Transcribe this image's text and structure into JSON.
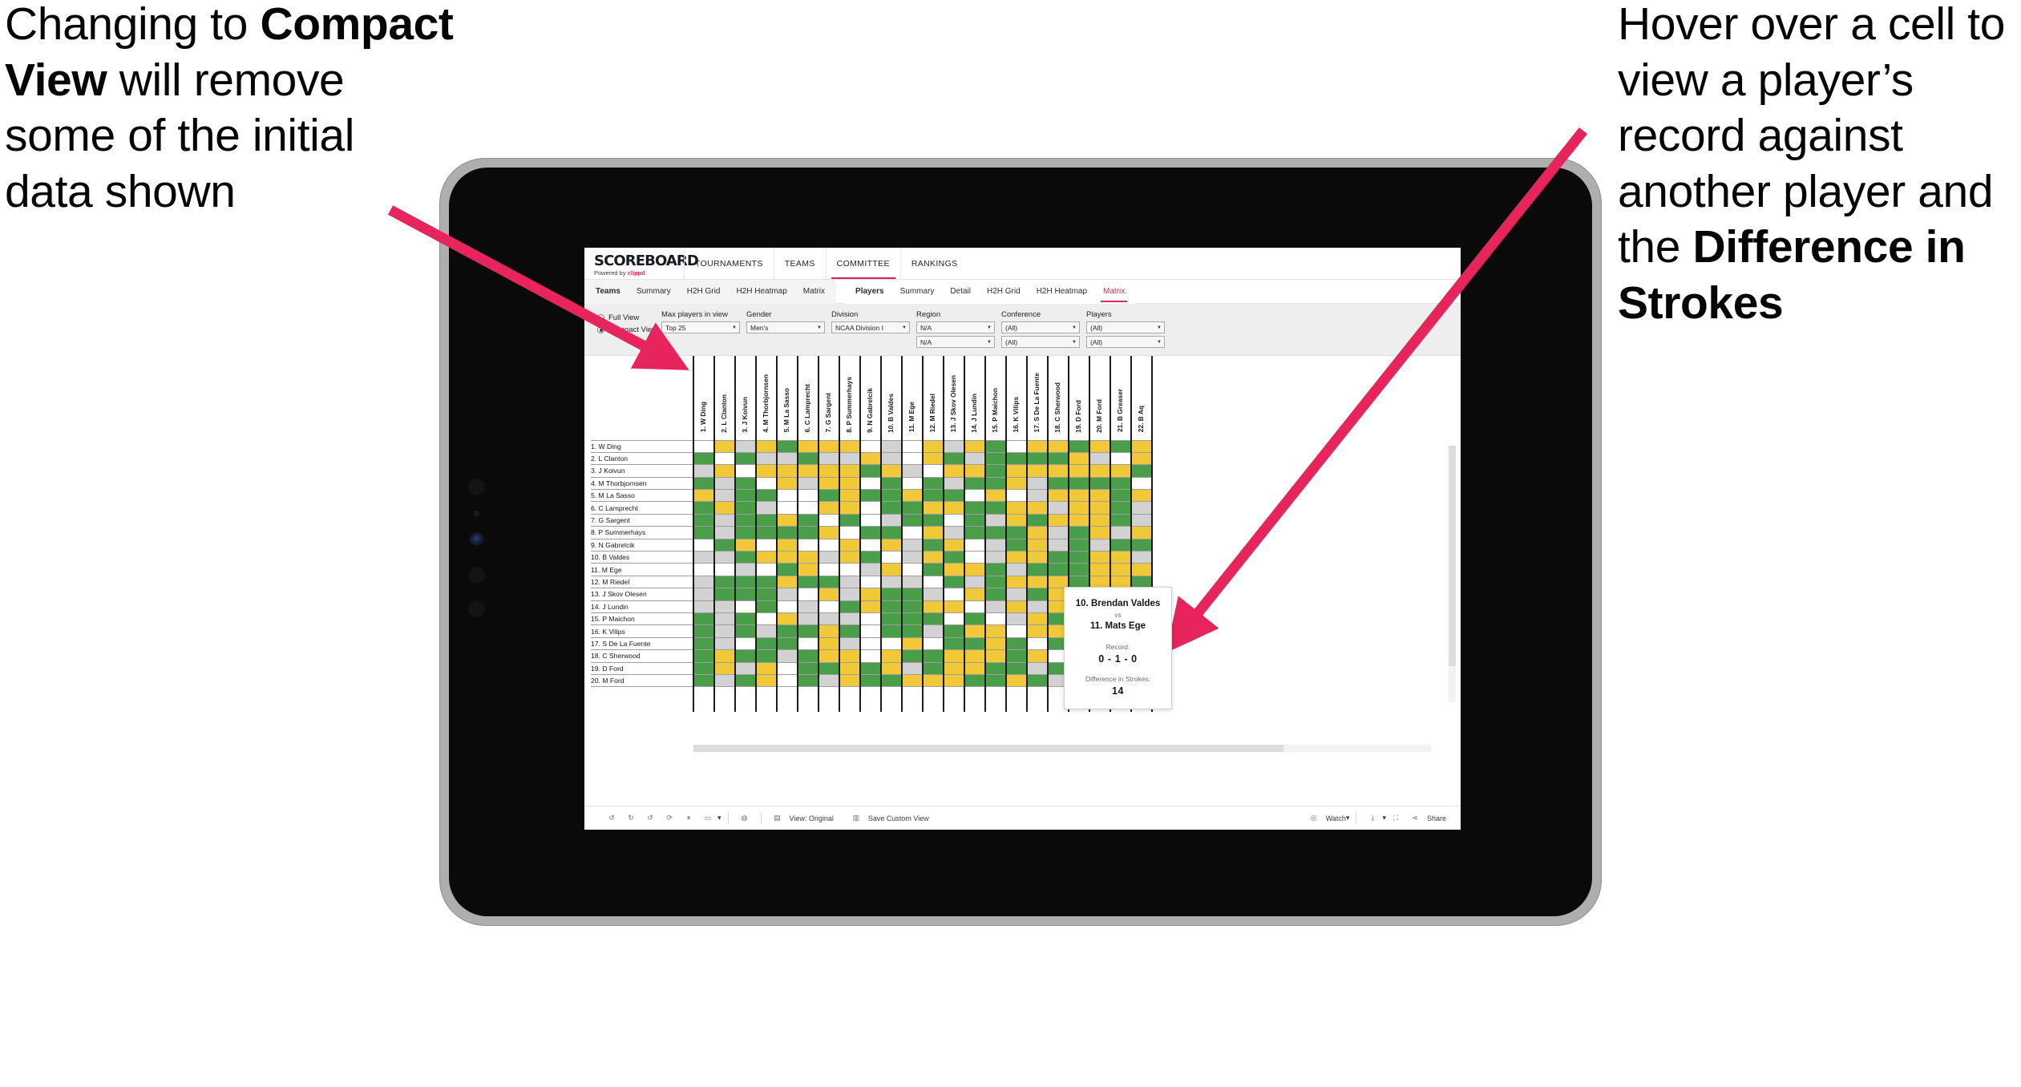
{
  "annotations": {
    "left": {
      "part1": "Changing to ",
      "bold": "Compact View",
      "part2": " will remove some of the initial data shown"
    },
    "right": {
      "part1": "Hover over a cell to view a player’s record against another player and the ",
      "bold": "Difference in Strokes",
      "part2": ""
    },
    "arrow_color": "#e8245d"
  },
  "app": {
    "brand": {
      "title": "SCOREBOARD",
      "sub_prefix": "Powered by ",
      "sub_brand": "clippd"
    },
    "topnav": [
      {
        "label": "TOURNAMENTS",
        "active": false
      },
      {
        "label": "TEAMS",
        "active": false
      },
      {
        "label": "COMMITTEE",
        "active": true
      },
      {
        "label": "RANKINGS",
        "active": false
      }
    ],
    "tabs_teams": [
      {
        "label": "Teams",
        "head": true,
        "active": false
      },
      {
        "label": "Summary",
        "head": false,
        "active": false
      },
      {
        "label": "H2H Grid",
        "head": false,
        "active": false
      },
      {
        "label": "H2H Heatmap",
        "head": false,
        "active": false
      },
      {
        "label": "Matrix",
        "head": false,
        "active": false
      }
    ],
    "tabs_players": [
      {
        "label": "Players",
        "head": true,
        "active": false
      },
      {
        "label": "Summary",
        "head": false,
        "active": false
      },
      {
        "label": "Detail",
        "head": false,
        "active": false
      },
      {
        "label": "H2H Grid",
        "head": false,
        "active": false
      },
      {
        "label": "H2H Heatmap",
        "head": false,
        "active": false
      },
      {
        "label": "Matrix",
        "head": false,
        "active": true
      }
    ],
    "filters": {
      "view_modes": [
        {
          "label": "Full View",
          "selected": false
        },
        {
          "label": "Compact View",
          "selected": true
        }
      ],
      "max_players": {
        "label": "Max players in view",
        "value": "Top 25"
      },
      "gender": {
        "label": "Gender",
        "value": "Men's"
      },
      "division": {
        "label": "Division",
        "value": "NCAA Division I"
      },
      "region": {
        "label": "Region",
        "value": "N/A",
        "value2": "N/A"
      },
      "conference": {
        "label": "Conference",
        "value": "(All)",
        "value2": "(All)"
      },
      "players": {
        "label": "Players",
        "value": "(All)",
        "value2": "(All)"
      }
    },
    "toolbar": {
      "view_label": "View: Original",
      "save_label": "Save Custom View",
      "watch_label": "Watch",
      "share_label": "Share"
    },
    "tooltip": {
      "player_a": "10. Brendan Valdes",
      "vs": "vs",
      "player_b": "11. Mats Ege",
      "record_label": "Record:",
      "record_value": "0 - 1 - 0",
      "diff_label": "Difference in Strokes:",
      "diff_value": "14"
    }
  },
  "matrix": {
    "columns": [
      "1. W Ding",
      "2. L Clanton",
      "3. J Koivun",
      "4. M Thorbjornsen",
      "5. M La Sasso",
      "6. C Lamprecht",
      "7. G Sargent",
      "8. P Summerhays",
      "9. N Gabrelcik",
      "10. B Valdes",
      "11. M Ege",
      "12. M Riedel",
      "13. J Skov Olesen",
      "14. J Lundin",
      "15. P Maichon",
      "16. K Vilips",
      "17. S De La Fuente",
      "18. C Sherwood",
      "19. D Ford",
      "20. M Ford",
      "21. B Greaser",
      "22. B Aq"
    ],
    "rows": [
      "1. W Ding",
      "2. L Clanton",
      "3. J Koivun",
      "4. M Thorbjornsen",
      "5. M La Sasso",
      "6. C Lamprecht",
      "7. G Sargent",
      "8. P Summerhays",
      "9. N Gabrelcik",
      "10. B Valdes",
      "11. M Ege",
      "12. M Riedel",
      "13. J Skov Olesen",
      "14. J Lundin",
      "15. P Maichon",
      "16. K Vilips",
      "17. S De La Fuente",
      "18. C Sherwood",
      "19. D Ford",
      "20. M Ford"
    ],
    "legend": {
      "win": "#4a9e4a",
      "tie": "#f0c838",
      "loss": "#d2d2d2",
      "none": "#ffffff"
    },
    "cells": [
      [
        "w",
        "y",
        "a",
        "y",
        "g",
        "y",
        "y",
        "y",
        "w",
        "a",
        "w",
        "y",
        "a",
        "y",
        "g",
        "w",
        "y",
        "y",
        "g",
        "y",
        "g",
        "y"
      ],
      [
        "g",
        "w",
        "g",
        "a",
        "a",
        "g",
        "a",
        "a",
        "y",
        "a",
        "w",
        "y",
        "g",
        "a",
        "g",
        "g",
        "g",
        "g",
        "y",
        "a",
        "w",
        "y"
      ],
      [
        "a",
        "y",
        "w",
        "y",
        "y",
        "y",
        "y",
        "y",
        "g",
        "y",
        "a",
        "w",
        "y",
        "y",
        "g",
        "y",
        "y",
        "y",
        "y",
        "y",
        "y",
        "g"
      ],
      [
        "g",
        "a",
        "g",
        "w",
        "y",
        "a",
        "y",
        "y",
        "w",
        "g",
        "w",
        "g",
        "a",
        "g",
        "g",
        "y",
        "a",
        "g",
        "g",
        "g",
        "g",
        "w"
      ],
      [
        "y",
        "a",
        "g",
        "g",
        "w",
        "w",
        "g",
        "y",
        "g",
        "g",
        "y",
        "g",
        "g",
        "w",
        "y",
        "w",
        "a",
        "y",
        "y",
        "y",
        "g",
        "y"
      ],
      [
        "g",
        "y",
        "g",
        "a",
        "w",
        "w",
        "y",
        "y",
        "w",
        "g",
        "g",
        "y",
        "y",
        "g",
        "g",
        "y",
        "y",
        "a",
        "y",
        "y",
        "g",
        "a"
      ],
      [
        "g",
        "a",
        "g",
        "g",
        "y",
        "g",
        "w",
        "g",
        "w",
        "a",
        "g",
        "g",
        "w",
        "g",
        "a",
        "y",
        "g",
        "y",
        "y",
        "y",
        "g",
        "a"
      ],
      [
        "g",
        "a",
        "g",
        "g",
        "g",
        "g",
        "y",
        "w",
        "g",
        "g",
        "w",
        "y",
        "a",
        "g",
        "g",
        "g",
        "y",
        "a",
        "g",
        "y",
        "a",
        "y"
      ],
      [
        "w",
        "g",
        "y",
        "w",
        "y",
        "w",
        "w",
        "y",
        "w",
        "y",
        "a",
        "g",
        "y",
        "w",
        "a",
        "g",
        "y",
        "a",
        "g",
        "a",
        "g",
        "g"
      ],
      [
        "a",
        "a",
        "g",
        "y",
        "y",
        "y",
        "a",
        "y",
        "g",
        "w",
        "a",
        "y",
        "g",
        "w",
        "a",
        "y",
        "y",
        "g",
        "g",
        "y",
        "y",
        "a"
      ],
      [
        "w",
        "w",
        "a",
        "w",
        "g",
        "y",
        "w",
        "w",
        "a",
        "y",
        "w",
        "g",
        "y",
        "y",
        "g",
        "a",
        "g",
        "g",
        "g",
        "y",
        "y",
        "y"
      ],
      [
        "a",
        "g",
        "g",
        "g",
        "y",
        "g",
        "g",
        "a",
        "w",
        "a",
        "a",
        "w",
        "g",
        "a",
        "g",
        "y",
        "y",
        "y",
        "g",
        "y",
        "y",
        "g"
      ],
      [
        "a",
        "g",
        "g",
        "g",
        "a",
        "w",
        "y",
        "a",
        "y",
        "g",
        "g",
        "a",
        "w",
        "y",
        "g",
        "a",
        "g",
        "y",
        "g",
        "y",
        "y",
        "y"
      ],
      [
        "a",
        "a",
        "w",
        "g",
        "w",
        "a",
        "w",
        "g",
        "y",
        "g",
        "g",
        "y",
        "y",
        "w",
        "a",
        "y",
        "a",
        "y",
        "y",
        "g",
        "y",
        "g"
      ],
      [
        "g",
        "a",
        "g",
        "w",
        "y",
        "a",
        "a",
        "a",
        "w",
        "g",
        "g",
        "g",
        "w",
        "g",
        "w",
        "a",
        "y",
        "g",
        "y",
        "g",
        "g",
        "y"
      ],
      [
        "g",
        "a",
        "g",
        "a",
        "g",
        "g",
        "y",
        "g",
        "w",
        "g",
        "g",
        "a",
        "g",
        "y",
        "y",
        "w",
        "y",
        "y",
        "y",
        "y",
        "g",
        "y"
      ],
      [
        "g",
        "a",
        "w",
        "g",
        "g",
        "w",
        "y",
        "a",
        "w",
        "w",
        "y",
        "w",
        "g",
        "g",
        "y",
        "g",
        "w",
        "g",
        "a",
        "g",
        "y",
        "w"
      ],
      [
        "g",
        "y",
        "g",
        "g",
        "a",
        "g",
        "y",
        "y",
        "w",
        "y",
        "g",
        "g",
        "y",
        "y",
        "y",
        "g",
        "y",
        "w",
        "a",
        "g",
        "g",
        "g"
      ],
      [
        "g",
        "y",
        "a",
        "y",
        "w",
        "g",
        "g",
        "y",
        "g",
        "y",
        "a",
        "g",
        "y",
        "y",
        "g",
        "g",
        "a",
        "g",
        "w",
        "y",
        "y",
        "w"
      ],
      [
        "g",
        "a",
        "g",
        "y",
        "w",
        "g",
        "a",
        "y",
        "g",
        "g",
        "y",
        "y",
        "y",
        "g",
        "g",
        "y",
        "g",
        "a",
        "y",
        "w",
        "g",
        "g"
      ]
    ]
  }
}
